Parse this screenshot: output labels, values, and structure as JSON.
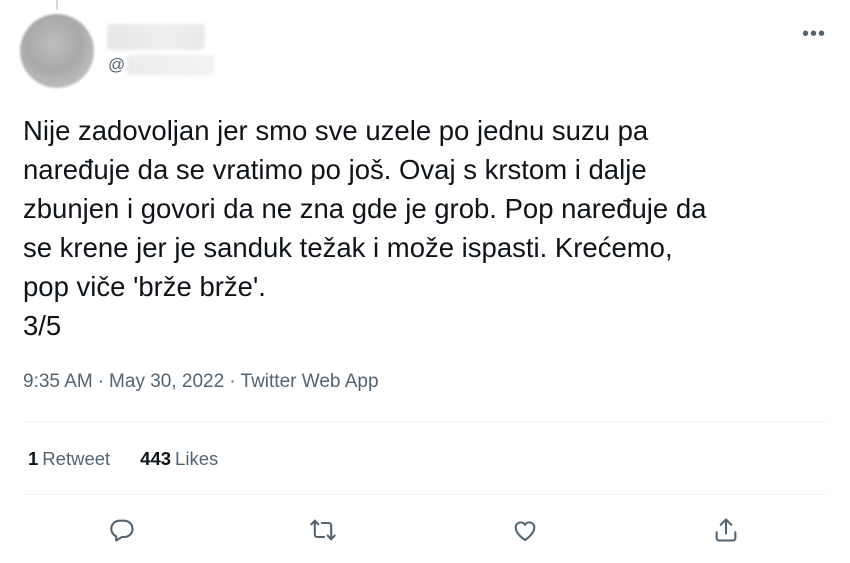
{
  "tweet": {
    "handle_prefix": "@",
    "more_glyph": "•••",
    "text": "Nije zadovoljan jer smo sve uzele po jednu suzu pa\nnaređuje da se vratimo po još. Ovaj s krstom i dalje\nzbunjen i govori da ne zna gde je grob. Pop naređuje da\nse krene jer je sanduk težak i može ispasti. Krećemo,\npop viče 'brže brže'.\n3/5",
    "time": "9:35 AM",
    "date": "May 30, 2022",
    "separator": "·",
    "source": "Twitter Web App"
  },
  "stats": {
    "retweets_count": "1",
    "retweets_label": "Retweet",
    "likes_count": "443",
    "likes_label": "Likes"
  },
  "actions": {
    "icons": [
      "reply-icon",
      "retweet-icon",
      "like-icon",
      "share-icon"
    ]
  },
  "colors": {
    "text": "#0f1419",
    "secondary": "#536471",
    "divider": "#eff3f4"
  }
}
